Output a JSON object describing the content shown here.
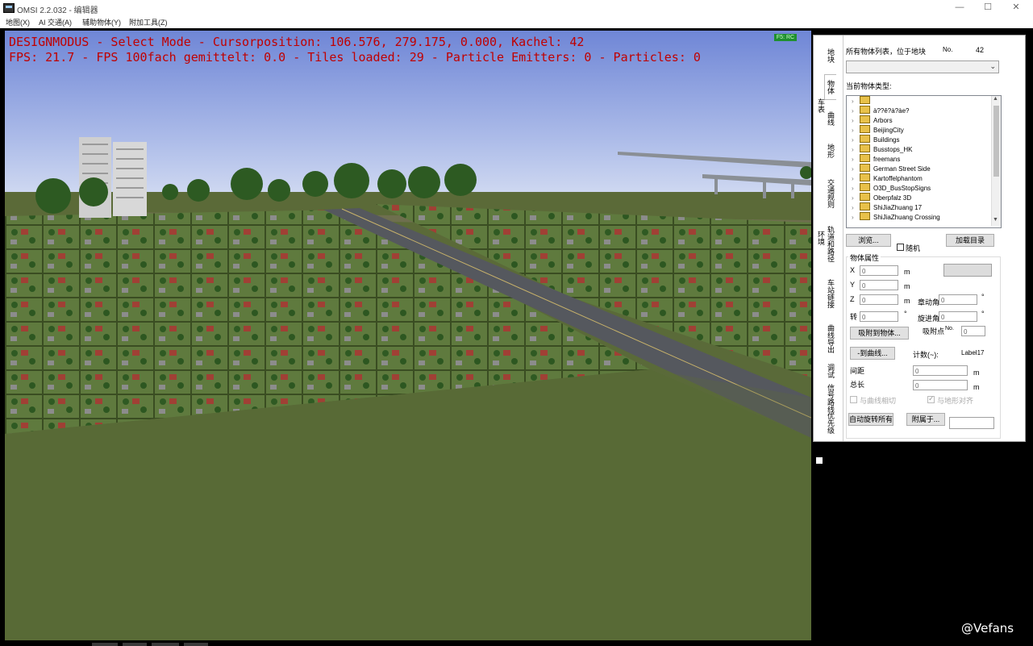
{
  "window": {
    "title": "OMSI 2.2.032 - 编辑器",
    "controls": {
      "minimize": "—",
      "maximize": "☐",
      "close": "✕"
    }
  },
  "menu": [
    "地图(X)",
    "AI 交通(A)",
    "辅助物体(Y)",
    "附加工具(Z)"
  ],
  "hud": {
    "line1": "DESIGNMODUS - Select Mode - Cursorposition: 106.576, 279.175, 0.000, Kachel: 42",
    "line2": "FPS: 21.7 - FPS 100fach gemittelt: 0.0 - Tiles loaded: 29 - Particle Emitters: 0 - Particles: 0",
    "color": "#c00000"
  },
  "side_tabs": [
    "地块",
    "物体",
    "曲线",
    "地形",
    "交通规则",
    "轨道和路径",
    "车站链接",
    "曲线导出",
    "调试",
    "信号路线",
    "优先级"
  ],
  "side_tab_active": "物体",
  "side_tab_extra": [
    "车表",
    "环境"
  ],
  "objects": {
    "list_label": "所有物体列表，位于地块",
    "no_label": "No.",
    "tile_no": "42",
    "type_label": "当前物体类型:",
    "tree": [
      "",
      "à??ê?à?àe?",
      "Arbors",
      "BeijingCity",
      "Buildings",
      "Busstops_HK",
      "freemans",
      "German Street Side",
      "Kartoffelphantom",
      "O3D_BusStopSigns",
      "Oberpfalz 3D",
      "ShiJiaZhuang 17",
      "ShiJiaZhuang Crossing"
    ],
    "browse_button": "浏览...",
    "random_label": "随机",
    "load_button": "加载目录",
    "props_label": "物体属性",
    "x_label": "X",
    "y_label": "Y",
    "z_label": "Z",
    "rot_label": "转",
    "x_value": "0",
    "y_value": "0",
    "z_value": "0",
    "rot_value": "0",
    "unit_m": "m",
    "unit_deg": "°",
    "pitch_label": "章动角",
    "pitch_value": "0",
    "yaw_label": "旋进角",
    "yaw_value": "0",
    "snap_button": "吸附到物体...",
    "snap_point_label": "吸附点",
    "snap_no_label": "No.",
    "snap_no_value": "0",
    "curve_button": "-到曲线...",
    "count_label": "计数(~):",
    "count_value": "Label17",
    "spacing_label": "间距",
    "spacing_value": "0",
    "total_label": "总长",
    "total_value": "0",
    "tangent_label": "与曲线相切",
    "terrain_label": "与地形对齐",
    "autorotate_button": "自动旋转所有",
    "attach_button": "附属于..."
  },
  "watermark": "@Vefans",
  "status_badge": "F5: RC"
}
